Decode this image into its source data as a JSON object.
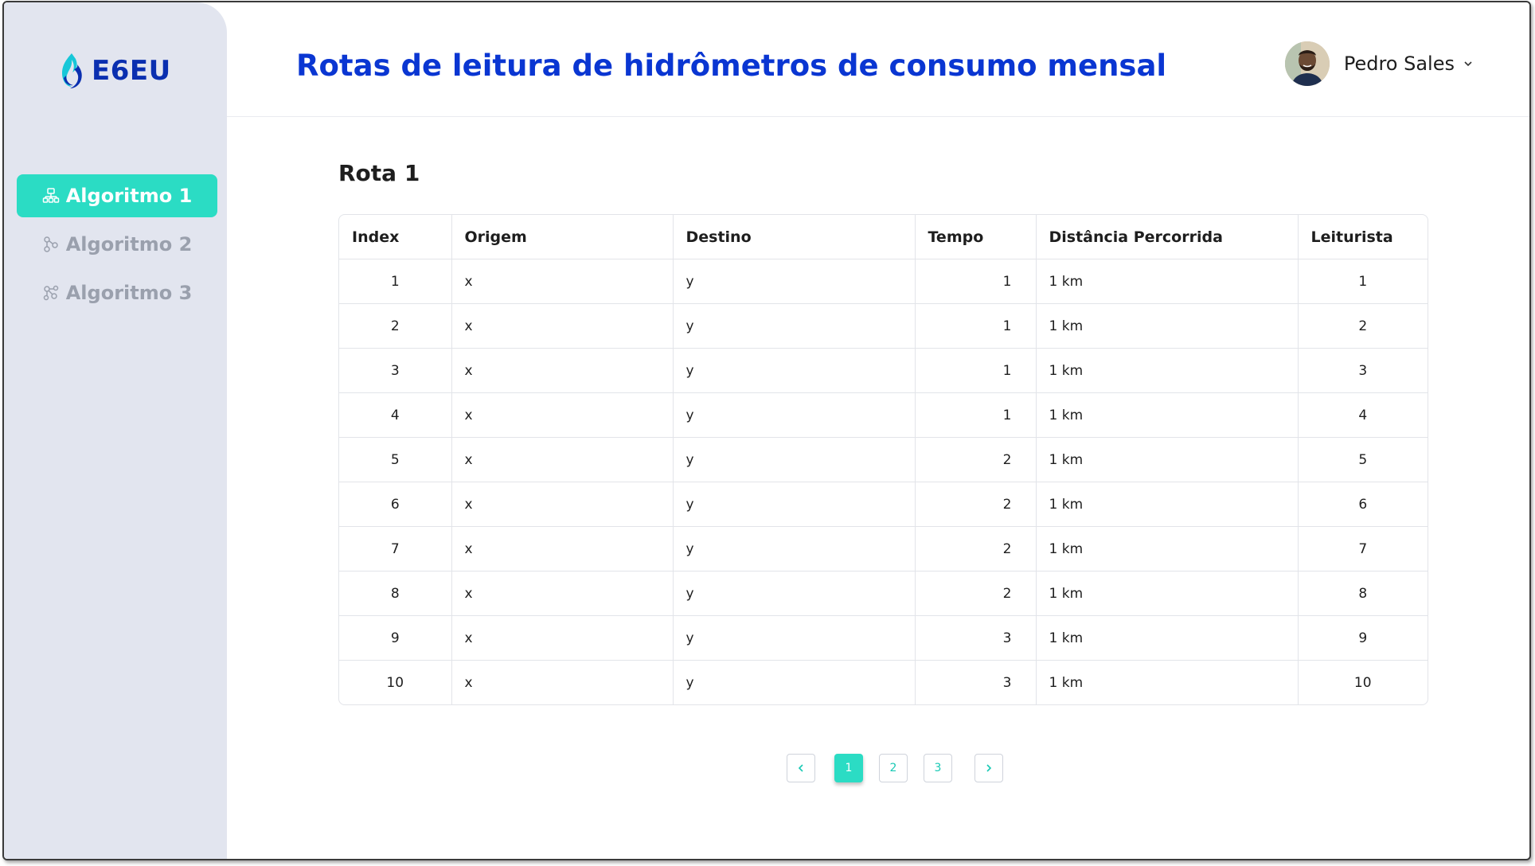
{
  "brand": {
    "name": "E6EU"
  },
  "sidebar": {
    "items": [
      {
        "label": "Algoritmo 1",
        "icon": "sitemap-icon",
        "active": true
      },
      {
        "label": "Algoritmo 2",
        "icon": "nodes-icon",
        "active": false
      },
      {
        "label": "Algoritmo 3",
        "icon": "network-icon",
        "active": false
      }
    ]
  },
  "header": {
    "title": "Rotas de leitura de hidrômetros de consumo mensal",
    "user": {
      "name": "Pedro Sales"
    }
  },
  "main": {
    "section_title": "Rota 1",
    "table": {
      "columns": [
        "Index",
        "Origem",
        "Destino",
        "Tempo",
        "Distância Percorrida",
        "Leiturista"
      ],
      "rows": [
        [
          "1",
          "x",
          "y",
          "1",
          "1 km",
          "1"
        ],
        [
          "2",
          "x",
          "y",
          "1",
          "1 km",
          "2"
        ],
        [
          "3",
          "x",
          "y",
          "1",
          "1 km",
          "3"
        ],
        [
          "4",
          "x",
          "y",
          "1",
          "1 km",
          "4"
        ],
        [
          "5",
          "x",
          "y",
          "2",
          "1 km",
          "5"
        ],
        [
          "6",
          "x",
          "y",
          "2",
          "1 km",
          "6"
        ],
        [
          "7",
          "x",
          "y",
          "2",
          "1 km",
          "7"
        ],
        [
          "8",
          "x",
          "y",
          "2",
          "1 km",
          "8"
        ],
        [
          "9",
          "x",
          "y",
          "3",
          "1 km",
          "9"
        ],
        [
          "10",
          "x",
          "y",
          "3",
          "1 km",
          "10"
        ]
      ]
    },
    "pagination": {
      "pages": [
        "1",
        "2",
        "3"
      ],
      "current": "1"
    }
  },
  "colors": {
    "accent": "#2bdcc4",
    "title_blue": "#0a36d2",
    "brand_blue": "#0a2fb0",
    "sidebar_bg": "#e2e5ef"
  }
}
